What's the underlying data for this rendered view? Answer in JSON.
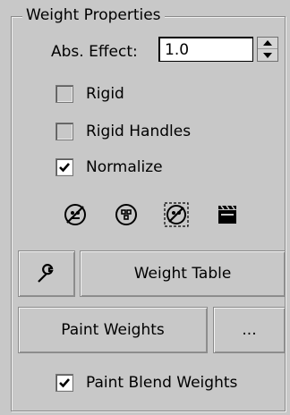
{
  "group": {
    "title": "Weight Properties"
  },
  "abs_effect": {
    "label": "Abs. Effect:",
    "value": "1.0"
  },
  "checkboxes": {
    "rigid": {
      "label": "Rigid",
      "checked": false
    },
    "rigid_handles": {
      "label": "Rigid Handles",
      "checked": false
    },
    "normalize": {
      "label": "Normalize",
      "checked": true
    },
    "paint_blend_weights": {
      "label": "Paint Blend Weights",
      "checked": true
    }
  },
  "tools": {
    "icons": [
      "exclude-verts-icon",
      "select-verts-icon",
      "select-exclude-verts-icon",
      "bake-clapper-icon"
    ]
  },
  "buttons": {
    "weight_table_label": "Weight Table",
    "paint_weights_label": "Paint Weights",
    "paint_options_label": "..."
  }
}
